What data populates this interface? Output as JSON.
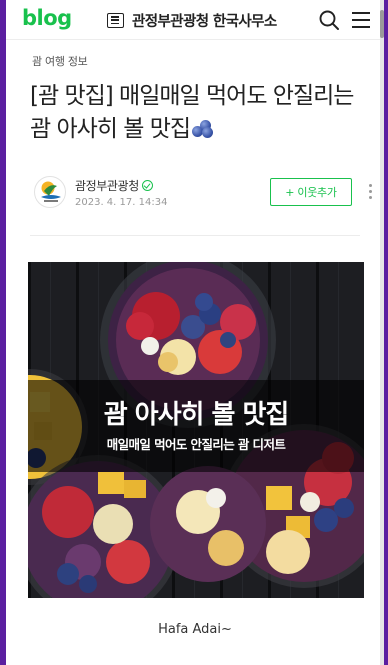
{
  "header": {
    "logo": "blog",
    "blog_title": "관정부관광청 한국사무소",
    "icons": [
      "list-icon",
      "search-icon",
      "menu-icon"
    ]
  },
  "post": {
    "category": "괌 여행 정보",
    "title": "[괌 맛집] 매일매일 먹어도 안질리는 괌 아사히 볼 맛집",
    "title_emoji": "blueberries-emoji",
    "author": "괌정부관광청",
    "date": "2023. 4. 17. 14:34",
    "neighbor_button": "+ 이웃추가"
  },
  "hero": {
    "title": "괌 아사히 볼 맛집",
    "subtitle": "매일매일 먹어도 안질리는 괌 디저트"
  },
  "body": {
    "greeting": "Hafa Adai~"
  },
  "colors": {
    "brand_green": "#19c14d",
    "frame_purple": "#5b1fa0",
    "text": "#222222"
  }
}
